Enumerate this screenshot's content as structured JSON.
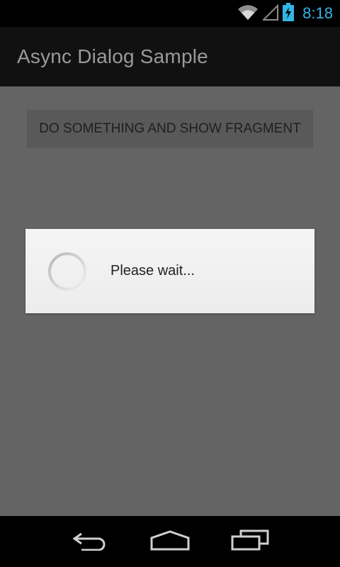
{
  "status_bar": {
    "time": "8:18",
    "icons": [
      "wifi-icon",
      "cell-signal-icon",
      "battery-charging-icon"
    ],
    "accent_color": "#33b5e5"
  },
  "action_bar": {
    "title": "Async Dialog Sample"
  },
  "main": {
    "button_label": "DO SOMETHING AND SHOW FRAGMENT"
  },
  "dialog": {
    "message": "Please wait..."
  },
  "nav_bar": {
    "buttons": [
      "back-icon",
      "home-icon",
      "recent-apps-icon"
    ]
  }
}
